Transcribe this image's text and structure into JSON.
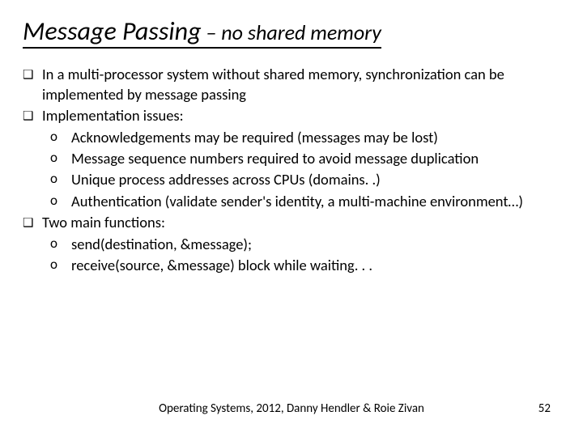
{
  "title": {
    "part1": "Message  Passing",
    "connector": " – ",
    "part2": "no shared memory"
  },
  "bullets": [
    {
      "type": "q",
      "text": "In a multi-processor system without shared memory, synchronization can be implemented by message passing"
    },
    {
      "type": "q",
      "text": "Implementation issues:"
    },
    {
      "type": "o",
      "text": "Acknowledgements may be required (messages may be lost)"
    },
    {
      "type": "o",
      "text": "Message sequence numbers required to avoid message duplication"
    },
    {
      "type": "o",
      "text": "Unique process addresses across CPUs (domains. .)"
    },
    {
      "type": "o",
      "text": "Authentication (validate sender's identity, a multi-machine environment…)"
    },
    {
      "type": "q",
      "text": " Two main functions:"
    },
    {
      "type": "o",
      "text": "send(destination, &message);"
    },
    {
      "type": "o",
      "text": "receive(source, &message)   block while waiting. . ."
    }
  ],
  "markers": {
    "q": "❑",
    "o": "o"
  },
  "footer": {
    "credit": "Operating Systems, 2012,  Danny Hendler & Roie Zivan",
    "page": "52"
  }
}
